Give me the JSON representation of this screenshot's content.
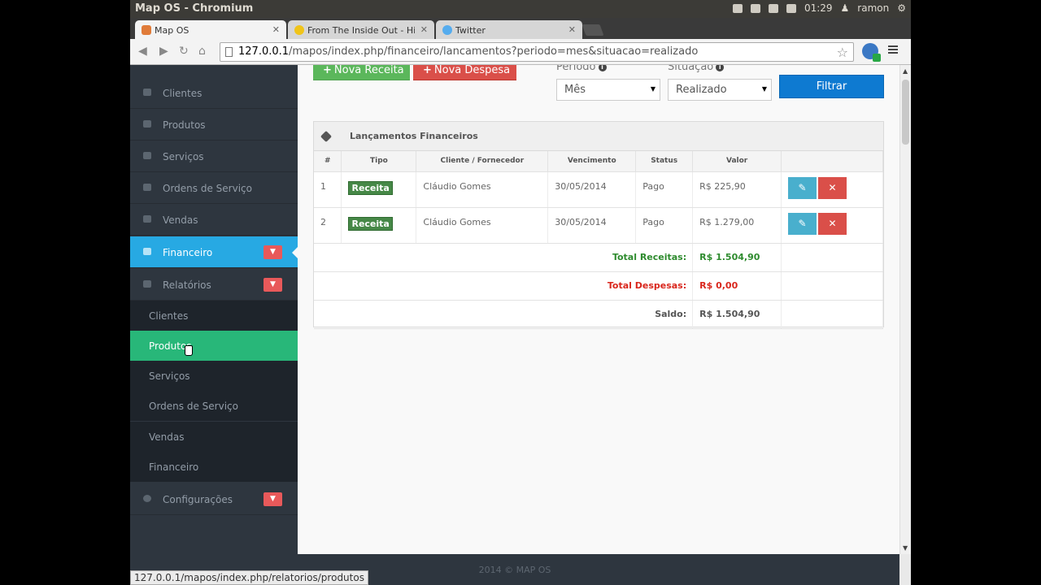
{
  "os": {
    "window_title": "Map OS - Chromium",
    "clock": "01:29",
    "user": "ramon"
  },
  "tabs": [
    {
      "label": "Map OS",
      "favicon_color": "#e07b39"
    },
    {
      "label": "From The Inside Out - Hills",
      "favicon_color": "#f0c419"
    },
    {
      "label": "Twitter",
      "favicon_color": "#55acee"
    }
  ],
  "address": {
    "host": "127.0.0.1",
    "path": "/mapos/index.php/financeiro/lancamentos?periodo=mes&situacao=realizado"
  },
  "sidebar": {
    "items": [
      {
        "label": "Clientes",
        "icon": "group-icon"
      },
      {
        "label": "Produtos",
        "icon": "barcode-icon"
      },
      {
        "label": "Serviços",
        "icon": "wrench-icon"
      },
      {
        "label": "Ordens de Serviço",
        "icon": "tags-icon"
      },
      {
        "label": "Vendas",
        "icon": "cart-icon"
      },
      {
        "label": "Financeiro",
        "icon": "money-icon"
      },
      {
        "label": "Relatórios",
        "icon": "list-icon"
      }
    ],
    "submenu": [
      "Clientes",
      "Produtos",
      "Serviços",
      "Ordens de Serviço",
      "Vendas",
      "Financeiro"
    ],
    "config_label": "Configurações"
  },
  "actions": {
    "nova_receita": "Nova Receita",
    "nova_despesa": "Nova Despesa"
  },
  "filters": {
    "periodo_label": "Período",
    "periodo_value": "Mês",
    "situacao_label": "Situação",
    "situacao_value": "Realizado",
    "filtrar": "Filtrar"
  },
  "table": {
    "title": "Lançamentos Financeiros",
    "headers": [
      "#",
      "Tipo",
      "Cliente / Fornecedor",
      "Vencimento",
      "Status",
      "Valor"
    ],
    "rows": [
      {
        "num": "1",
        "tipo": "Receita",
        "cliente": "Cláudio Gomes",
        "vencimento": "30/05/2014",
        "status": "Pago",
        "valor": "R$ 225,90"
      },
      {
        "num": "2",
        "tipo": "Receita",
        "cliente": "Cláudio Gomes",
        "vencimento": "30/05/2014",
        "status": "Pago",
        "valor": "R$ 1.279,00"
      }
    ],
    "totals": {
      "receitas_label": "Total Receitas:",
      "receitas_value": "R$ 1.504,90",
      "despesas_label": "Total Despesas:",
      "despesas_value": "R$ 0,00",
      "saldo_label": "Saldo:",
      "saldo_value": "R$ 1.504,90"
    }
  },
  "footer": "2014 © MAP OS",
  "status_url": "127.0.0.1/mapos/index.php/relatorios/produtos"
}
